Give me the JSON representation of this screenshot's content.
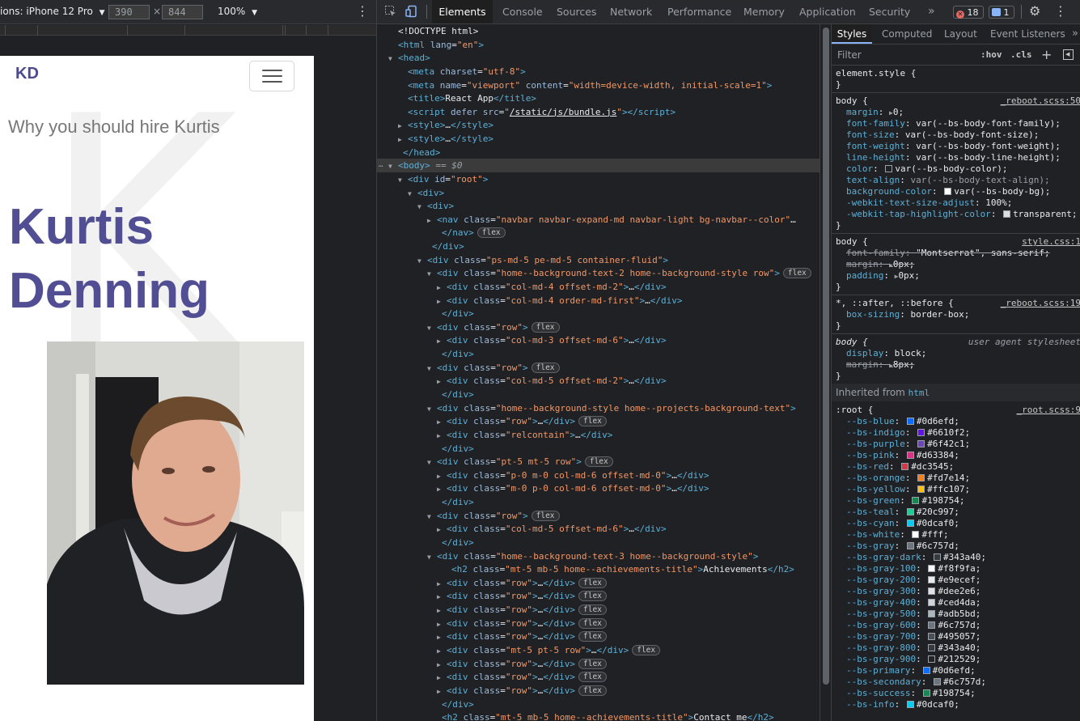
{
  "device_toolbar": {
    "device_label": "ions: iPhone 12 Pro",
    "width": "390",
    "height": "844",
    "times": "×",
    "zoom": "100%"
  },
  "emulated_page": {
    "brand": "KD",
    "background_letter": "K",
    "tagline": "Why you should hire Kurtis",
    "name_line1": "Kurtis",
    "name_line2": "Denning"
  },
  "devtools_tabs": [
    "Elements",
    "Console",
    "Sources",
    "Network",
    "Performance",
    "Memory",
    "Application",
    "Security"
  ],
  "devtools_more": "»",
  "error_count": "18",
  "message_count": "1",
  "dom": [
    {
      "i": 0,
      "t": "",
      "h": "<span class='str'>&lt;!DOCTYPE html&gt;</span>"
    },
    {
      "i": 0,
      "t": "",
      "h": "<span class='tag'>&lt;html</span> <span class='attr'>lang</span>=<span class='val'>\"en\"</span><span class='tag'>&gt;</span>"
    },
    {
      "i": 0,
      "t": "▼",
      "h": "<span class='tag'>&lt;head&gt;</span>"
    },
    {
      "i": 1,
      "t": "",
      "h": "<span class='tag'>&lt;meta</span> <span class='attr'>charset</span>=<span class='val'>\"utf-8\"</span><span class='tag'>&gt;</span>"
    },
    {
      "i": 1,
      "t": "",
      "h": "<span class='tag'>&lt;meta</span> <span class='attr'>name</span>=<span class='val'>\"viewport\"</span> <span class='attr'>content</span>=<span class='val'>\"width=device-width, initial-scale=1\"</span><span class='tag'>&gt;</span>"
    },
    {
      "i": 1,
      "t": "",
      "h": "<span class='tag'>&lt;title&gt;</span>React App<span class='tag'>&lt;/title&gt;</span>"
    },
    {
      "i": 1,
      "t": "",
      "h": "<span class='tag'>&lt;script</span> <span class='attr'>defer</span> <span class='attr'>src</span>=<span class='val'>\"</span><span class='link'>/static/js/bundle.js</span><span class='val'>\"</span><span class='tag'>&gt;&lt;/script&gt;</span>"
    },
    {
      "i": 1,
      "t": "▶",
      "h": "<span class='tag'>&lt;style&gt;</span>…<span class='tag'>&lt;/style&gt;</span>"
    },
    {
      "i": 1,
      "t": "▶",
      "h": "<span class='tag'>&lt;style&gt;</span>…<span class='tag'>&lt;/style&gt;</span>"
    },
    {
      "i": 0.5,
      "t": "",
      "h": "<span class='tag'>&lt;/head&gt;</span>"
    },
    {
      "i": 0,
      "t": "▼",
      "h": "<span class='tag'>&lt;body&gt;</span> <span class='cmt'>== $0</span>",
      "sel": true
    },
    {
      "i": 1,
      "t": "▼",
      "h": "<span class='tag'>&lt;div</span> <span class='attr'>id</span>=<span class='val'>\"root\"</span><span class='tag'>&gt;</span>"
    },
    {
      "i": 2,
      "t": "▼",
      "h": "<span class='tag'>&lt;div&gt;</span>"
    },
    {
      "i": 3,
      "t": "▼",
      "h": "<span class='tag'>&lt;div&gt;</span>"
    },
    {
      "i": 4,
      "t": "▶",
      "h": "<span class='tag'>&lt;nav</span> <span class='attr'>class</span>=<span class='val'>\"navbar navbar-expand-md navbar-light bg-navbar--color\"</span>…"
    },
    {
      "i": 4.5,
      "t": "",
      "h": "<span class='tag'>&lt;/nav&gt;</span>",
      "pill": "flex"
    },
    {
      "i": 3.5,
      "t": "",
      "h": "<span class='tag'>&lt;/div&gt;</span>"
    },
    {
      "i": 3,
      "t": "▼",
      "h": "<span class='tag'>&lt;div</span> <span class='attr'>class</span>=<span class='val'>\"ps-md-5 pe-md-5 container-fluid\"</span><span class='tag'>&gt;</span>"
    },
    {
      "i": 4,
      "t": "▼",
      "h": "<span class='tag'>&lt;div</span> <span class='attr'>class</span>=<span class='val'>\"home--background-text-2 home--background-style row\"</span><span class='tag'>&gt;</span>",
      "pill": "flex"
    },
    {
      "i": 5,
      "t": "▶",
      "h": "<span class='tag'>&lt;div</span> <span class='attr'>class</span>=<span class='val'>\"col-md-4 offset-md-2\"</span><span class='tag'>&gt;</span>…<span class='tag'>&lt;/div&gt;</span>"
    },
    {
      "i": 5,
      "t": "▶",
      "h": "<span class='tag'>&lt;div</span> <span class='attr'>class</span>=<span class='val'>\"col-md-4 order-md-first\"</span><span class='tag'>&gt;</span>…<span class='tag'>&lt;/div&gt;</span>"
    },
    {
      "i": 4.5,
      "t": "",
      "h": "<span class='tag'>&lt;/div&gt;</span>"
    },
    {
      "i": 4,
      "t": "▼",
      "h": "<span class='tag'>&lt;div</span> <span class='attr'>class</span>=<span class='val'>\"row\"</span><span class='tag'>&gt;</span>",
      "pill": "flex"
    },
    {
      "i": 5,
      "t": "▶",
      "h": "<span class='tag'>&lt;div</span> <span class='attr'>class</span>=<span class='val'>\"col-md-3 offset-md-6\"</span><span class='tag'>&gt;</span>…<span class='tag'>&lt;/div&gt;</span>"
    },
    {
      "i": 4.5,
      "t": "",
      "h": "<span class='tag'>&lt;/div&gt;</span>"
    },
    {
      "i": 4,
      "t": "▼",
      "h": "<span class='tag'>&lt;div</span> <span class='attr'>class</span>=<span class='val'>\"row\"</span><span class='tag'>&gt;</span>",
      "pill": "flex"
    },
    {
      "i": 5,
      "t": "▶",
      "h": "<span class='tag'>&lt;div</span> <span class='attr'>class</span>=<span class='val'>\"col-md-5 offset-md-2\"</span><span class='tag'>&gt;</span>…<span class='tag'>&lt;/div&gt;</span>"
    },
    {
      "i": 4.5,
      "t": "",
      "h": "<span class='tag'>&lt;/div&gt;</span>"
    },
    {
      "i": 4,
      "t": "▼",
      "h": "<span class='tag'>&lt;div</span> <span class='attr'>class</span>=<span class='val'>\"home--background-style home--projects-background-text\"</span><span class='tag'>&gt;</span>"
    },
    {
      "i": 5,
      "t": "▶",
      "h": "<span class='tag'>&lt;div</span> <span class='attr'>class</span>=<span class='val'>\"row\"</span><span class='tag'>&gt;</span>…<span class='tag'>&lt;/div&gt;</span>",
      "pill": "flex"
    },
    {
      "i": 5,
      "t": "▶",
      "h": "<span class='tag'>&lt;div</span> <span class='attr'>class</span>=<span class='val'>\"relcontain\"</span><span class='tag'>&gt;</span>…<span class='tag'>&lt;/div&gt;</span>"
    },
    {
      "i": 4.5,
      "t": "",
      "h": "<span class='tag'>&lt;/div&gt;</span>"
    },
    {
      "i": 4,
      "t": "▼",
      "h": "<span class='tag'>&lt;div</span> <span class='attr'>class</span>=<span class='val'>\"pt-5 mt-5 row\"</span><span class='tag'>&gt;</span>",
      "pill": "flex"
    },
    {
      "i": 5,
      "t": "▶",
      "h": "<span class='tag'>&lt;div</span> <span class='attr'>class</span>=<span class='val'>\"p-0 m-0 col-md-6 offset-md-0\"</span><span class='tag'>&gt;</span>…<span class='tag'>&lt;/div&gt;</span>"
    },
    {
      "i": 5,
      "t": "▶",
      "h": "<span class='tag'>&lt;div</span> <span class='attr'>class</span>=<span class='val'>\"m-0 p-0 col-md-6 offset-md-0\"</span><span class='tag'>&gt;</span>…<span class='tag'>&lt;/div&gt;</span>"
    },
    {
      "i": 4.5,
      "t": "",
      "h": "<span class='tag'>&lt;/div&gt;</span>"
    },
    {
      "i": 4,
      "t": "▼",
      "h": "<span class='tag'>&lt;div</span> <span class='attr'>class</span>=<span class='val'>\"row\"</span><span class='tag'>&gt;</span>",
      "pill": "flex"
    },
    {
      "i": 5,
      "t": "▶",
      "h": "<span class='tag'>&lt;div</span> <span class='attr'>class</span>=<span class='val'>\"col-md-5 offset-md-6\"</span><span class='tag'>&gt;</span>…<span class='tag'>&lt;/div&gt;</span>"
    },
    {
      "i": 4.5,
      "t": "",
      "h": "<span class='tag'>&lt;/div&gt;</span>"
    },
    {
      "i": 4,
      "t": "▼",
      "h": "<span class='tag'>&lt;div</span> <span class='attr'>class</span>=<span class='val'>\"home--background-text-3 home--background-style\"</span><span class='tag'>&gt;</span>"
    },
    {
      "i": 5.5,
      "t": "",
      "h": "<span class='tag'>&lt;h2</span> <span class='attr'>class</span>=<span class='val'>\"mt-5 mb-5 home--achievements-title\"</span><span class='tag'>&gt;</span>Achievements<span class='tag'>&lt;/h2&gt;</span>"
    },
    {
      "i": 5,
      "t": "▶",
      "h": "<span class='tag'>&lt;div</span> <span class='attr'>class</span>=<span class='val'>\"row\"</span><span class='tag'>&gt;</span>…<span class='tag'>&lt;/div&gt;</span>",
      "pill": "flex"
    },
    {
      "i": 5,
      "t": "▶",
      "h": "<span class='tag'>&lt;div</span> <span class='attr'>class</span>=<span class='val'>\"row\"</span><span class='tag'>&gt;</span>…<span class='tag'>&lt;/div&gt;</span>",
      "pill": "flex"
    },
    {
      "i": 5,
      "t": "▶",
      "h": "<span class='tag'>&lt;div</span> <span class='attr'>class</span>=<span class='val'>\"row\"</span><span class='tag'>&gt;</span>…<span class='tag'>&lt;/div&gt;</span>",
      "pill": "flex"
    },
    {
      "i": 5,
      "t": "▶",
      "h": "<span class='tag'>&lt;div</span> <span class='attr'>class</span>=<span class='val'>\"row\"</span><span class='tag'>&gt;</span>…<span class='tag'>&lt;/div&gt;</span>",
      "pill": "flex"
    },
    {
      "i": 5,
      "t": "▶",
      "h": "<span class='tag'>&lt;div</span> <span class='attr'>class</span>=<span class='val'>\"row\"</span><span class='tag'>&gt;</span>…<span class='tag'>&lt;/div&gt;</span>",
      "pill": "flex"
    },
    {
      "i": 5,
      "t": "▶",
      "h": "<span class='tag'>&lt;div</span> <span class='attr'>class</span>=<span class='val'>\"mt-5 pt-5 row\"</span><span class='tag'>&gt;</span>…<span class='tag'>&lt;/div&gt;</span>",
      "pill": "flex"
    },
    {
      "i": 5,
      "t": "▶",
      "h": "<span class='tag'>&lt;div</span> <span class='attr'>class</span>=<span class='val'>\"row\"</span><span class='tag'>&gt;</span>…<span class='tag'>&lt;/div&gt;</span>",
      "pill": "flex"
    },
    {
      "i": 5,
      "t": "▶",
      "h": "<span class='tag'>&lt;div</span> <span class='attr'>class</span>=<span class='val'>\"row\"</span><span class='tag'>&gt;</span>…<span class='tag'>&lt;/div&gt;</span>",
      "pill": "flex"
    },
    {
      "i": 5,
      "t": "▶",
      "h": "<span class='tag'>&lt;div</span> <span class='attr'>class</span>=<span class='val'>\"row\"</span><span class='tag'>&gt;</span>…<span class='tag'>&lt;/div&gt;</span>",
      "pill": "flex"
    },
    {
      "i": 4.5,
      "t": "",
      "h": "<span class='tag'>&lt;/div&gt;</span>"
    },
    {
      "i": 4.5,
      "t": "",
      "h": "<span class='tag'>&lt;h2</span> <span class='attr'>class</span>=<span class='val'>\"mt-5 mb-5 home--achievements-title\"</span><span class='tag'>&gt;</span>Contact me<span class='tag'>&lt;/h2&gt;</span>"
    }
  ],
  "styles_tabs": [
    "Styles",
    "Computed",
    "Layout",
    "Event Listeners"
  ],
  "styles_more": "»",
  "filter_placeholder": "Filter",
  "hov_label": ":hov",
  "cls_label": ".cls",
  "element_style": "element.style {",
  "body_rule_1": {
    "selector": "body {",
    "source": "_reboot.scss:50",
    "props": [
      {
        "p": "margin",
        "v": "0;",
        "tri": true
      },
      {
        "p": "font-family",
        "v": "var(--bs-body-font-family);"
      },
      {
        "p": "font-size",
        "v": "var(--bs-body-font-size);"
      },
      {
        "p": "font-weight",
        "v": "var(--bs-body-font-weight);"
      },
      {
        "p": "line-height",
        "v": "var(--bs-body-line-height);"
      },
      {
        "p": "color",
        "v": "var(--bs-body-color);",
        "sw": "#202124"
      },
      {
        "p": "text-align",
        "v": "var(--bs-body-text-align);",
        "dim": true
      },
      {
        "p": "background-color",
        "v": "var(--bs-body-bg);",
        "sw": "#ffffff"
      },
      {
        "p": "-webkit-text-size-adjust",
        "v": "100%;"
      },
      {
        "p": "-webkit-tap-highlight-color",
        "v": "transparent;",
        "sw": "#dddddd"
      }
    ]
  },
  "body_rule_2": {
    "selector": "body {",
    "source": "style.css:1",
    "props": [
      {
        "p": "font-family",
        "v": "\"Montserrat\", sans-serif;",
        "strike": true
      },
      {
        "p": "margin",
        "v": "0px;",
        "strike": true,
        "tri": true
      },
      {
        "p": "padding",
        "v": "0px;",
        "tri": true
      }
    ]
  },
  "universal_rule": {
    "selector": "*, ::after, ::before {",
    "source": "_reboot.scss:19",
    "props": [
      {
        "p": "box-sizing",
        "v": "border-box;"
      }
    ]
  },
  "ua_rule": {
    "selector": "body {",
    "source": "user agent stylesheet",
    "props": [
      {
        "p": "display",
        "v": "block;"
      },
      {
        "p": "margin",
        "v": "8px;",
        "strike": true,
        "tri": true
      }
    ]
  },
  "inherited_label": "Inherited from",
  "inherited_tag": "html",
  "root_rule": {
    "selector": ":root {",
    "source": "_root.scss:9",
    "vars": [
      {
        "p": "--bs-blue",
        "v": "#0d6efd"
      },
      {
        "p": "--bs-indigo",
        "v": "#6610f2"
      },
      {
        "p": "--bs-purple",
        "v": "#6f42c1"
      },
      {
        "p": "--bs-pink",
        "v": "#d63384"
      },
      {
        "p": "--bs-red",
        "v": "#dc3545"
      },
      {
        "p": "--bs-orange",
        "v": "#fd7e14"
      },
      {
        "p": "--bs-yellow",
        "v": "#ffc107"
      },
      {
        "p": "--bs-green",
        "v": "#198754"
      },
      {
        "p": "--bs-teal",
        "v": "#20c997"
      },
      {
        "p": "--bs-cyan",
        "v": "#0dcaf0"
      },
      {
        "p": "--bs-white",
        "v": "#fff"
      },
      {
        "p": "--bs-gray",
        "v": "#6c757d"
      },
      {
        "p": "--bs-gray-dark",
        "v": "#343a40"
      },
      {
        "p": "--bs-gray-100",
        "v": "#f8f9fa"
      },
      {
        "p": "--bs-gray-200",
        "v": "#e9ecef"
      },
      {
        "p": "--bs-gray-300",
        "v": "#dee2e6"
      },
      {
        "p": "--bs-gray-400",
        "v": "#ced4da"
      },
      {
        "p": "--bs-gray-500",
        "v": "#adb5bd"
      },
      {
        "p": "--bs-gray-600",
        "v": "#6c757d"
      },
      {
        "p": "--bs-gray-700",
        "v": "#495057"
      },
      {
        "p": "--bs-gray-800",
        "v": "#343a40"
      },
      {
        "p": "--bs-gray-900",
        "v": "#212529"
      },
      {
        "p": "--bs-primary",
        "v": "#0d6efd"
      },
      {
        "p": "--bs-secondary",
        "v": "#6c757d"
      },
      {
        "p": "--bs-success",
        "v": "#198754"
      },
      {
        "p": "--bs-info",
        "v": "#0dcaf0"
      }
    ]
  }
}
